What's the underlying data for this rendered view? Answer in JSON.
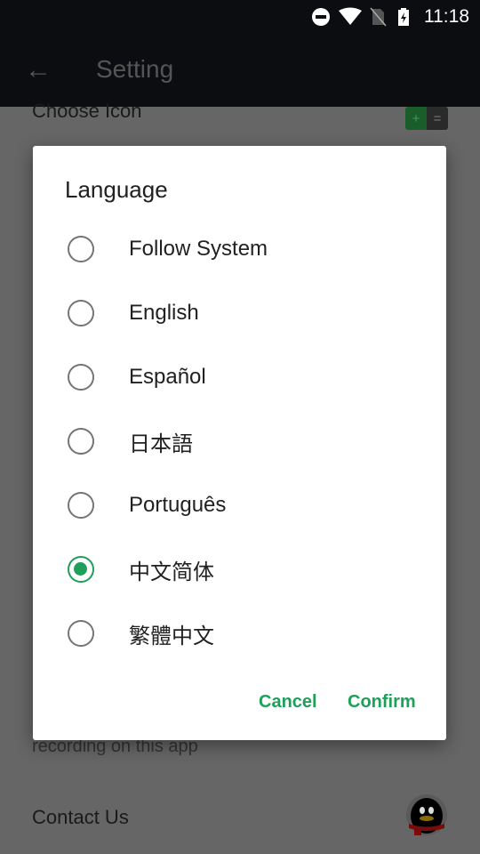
{
  "status_bar": {
    "time": "11:18",
    "icons": [
      "do-not-disturb-icon",
      "wifi-icon",
      "no-sim-icon",
      "battery-charging-icon"
    ]
  },
  "app_bar": {
    "title": "Setting"
  },
  "background": {
    "choose_icon": "Choose Icon",
    "partial_right": "s",
    "recording_text": "recording on this app",
    "contact_us": "Contact Us",
    "choose_icon_glyphs": [
      "+",
      "="
    ]
  },
  "dialog": {
    "title": "Language",
    "options": [
      {
        "label": "Follow System",
        "selected": false
      },
      {
        "label": "English",
        "selected": false
      },
      {
        "label": "Español",
        "selected": false
      },
      {
        "label": "日本語",
        "selected": false
      },
      {
        "label": "Português",
        "selected": false
      },
      {
        "label": "中文简体",
        "selected": true
      },
      {
        "label": "繁體中文",
        "selected": false
      }
    ],
    "cancel": "Cancel",
    "confirm": "Confirm"
  },
  "colors": {
    "accent": "#1fa05a",
    "scrim": "#666666",
    "bar": "#0c0d10"
  }
}
